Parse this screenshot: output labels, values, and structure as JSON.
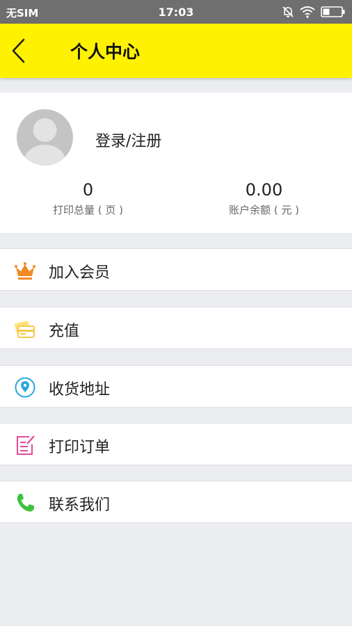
{
  "status": {
    "carrier": "无SIM",
    "time": "17:03"
  },
  "header": {
    "title": "个人中心"
  },
  "profile": {
    "login_label": "登录/注册",
    "stats": [
      {
        "value": "0",
        "label": "打印总量 ( 页 )"
      },
      {
        "value": "0.00",
        "label": "账户余额 ( 元 )"
      }
    ]
  },
  "menu": [
    {
      "label": "加入会员",
      "icon": "crown-icon"
    },
    {
      "label": "充值",
      "icon": "card-icon"
    },
    {
      "label": "收货地址",
      "icon": "location-pin-icon"
    },
    {
      "label": "打印订单",
      "icon": "order-edit-icon"
    },
    {
      "label": "联系我们",
      "icon": "phone-icon"
    }
  ],
  "colors": {
    "header_bg": "#fff200",
    "status_bg": "#6f6f6f",
    "page_bg": "#ecedf1"
  }
}
